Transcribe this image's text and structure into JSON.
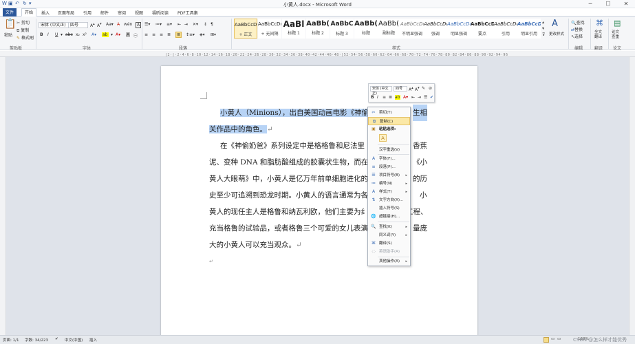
{
  "window": {
    "title": "小黄人.docx - Microsoft Word",
    "controls": [
      "─",
      "☐",
      "✕"
    ]
  },
  "tabs": [
    "文件",
    "开始",
    "插入",
    "页面布局",
    "引用",
    "邮件",
    "审阅",
    "视图",
    "福昕阅读",
    "PDF工具集"
  ],
  "ribbon": {
    "clipboard": {
      "paste": "粘贴",
      "cut": "剪切",
      "copy": "复制",
      "format_painter": "格式刷",
      "group": "剪贴板"
    },
    "font": {
      "name": "宋体 (中文正)",
      "size": "四号",
      "group": "字体"
    },
    "paragraph": {
      "group": "段落"
    },
    "styles": {
      "items": [
        {
          "preview": "AaBbCcDd",
          "name": "+ 正文"
        },
        {
          "preview": "AaBbCcDd",
          "name": "+ 无间隔"
        },
        {
          "preview": "AaBl",
          "name": "标题 1"
        },
        {
          "preview": "AaBb(",
          "name": "标题 2"
        },
        {
          "preview": "AaBbC",
          "name": "标题 3"
        },
        {
          "preview": "AaBb(",
          "name": "标题"
        },
        {
          "preview": "AaBb(",
          "name": "副标题"
        },
        {
          "preview": "AaBbCcDd",
          "name": "不明显强调"
        },
        {
          "preview": "AaBbCcDd",
          "name": "强调"
        },
        {
          "preview": "AaBbCcDd",
          "name": "明显强调"
        },
        {
          "preview": "AaBbCcDd",
          "name": "要点"
        },
        {
          "preview": "AaBbCcDd",
          "name": "引用"
        },
        {
          "preview": "AaBbCcDd",
          "name": "明显引用"
        }
      ],
      "change": "更改样式",
      "group": "样式"
    },
    "editing": {
      "find": "查找",
      "replace": "替换",
      "select": "选择",
      "group": "编辑"
    },
    "translate": {
      "full": "全文翻译",
      "group": "翻译"
    },
    "thesis": {
      "check": "论文查重",
      "group": "论文"
    }
  },
  "document": {
    "paragraphs": [
      [
        "小黄人（Minions），出自美国动画电影《神偷",
        "关作品中的角色。"
      ],
      [
        "在《神偷奶爸》系列设定中是格格鲁和尼法里",
        "泥、变种 DNA 和脂肪酸组成的胶囊状生物，而在小",
        "黄人大眼萌》中，小黄人是亿万年前单细胞进化的",
        "史至少可追溯到恐龙时期。小黄人的语言通常为各",
        "黄人的现任主人是格鲁和纳瓦利欧，他们主要为纟",
        "充当格鲁的试验品，或者格鲁三个可爱的女儿表演",
        "大的小黄人可以充当观众。"
      ]
    ],
    "tail_right": [
      "生相",
      "香蕉",
      "《小",
      "的历",
      "小",
      "工程、",
      "量庞"
    ]
  },
  "mini_toolbar": {
    "font": "宋体 (中文正)",
    "size": "四号"
  },
  "context_menu": {
    "items": [
      {
        "label": "剪切(T)",
        "icon": "cut-icon"
      },
      {
        "label": "复制(C)",
        "icon": "copy-icon",
        "hover": true
      },
      {
        "label": "粘贴选项:",
        "icon": "paste-icon"
      },
      {
        "label": "汉字重选(V)",
        "icon": ""
      },
      {
        "label": "字体(F)...",
        "icon": "font-icon"
      },
      {
        "label": "段落(P)...",
        "icon": "paragraph-icon"
      },
      {
        "label": "项目符号(B)",
        "icon": "bullets-icon",
        "sub": true
      },
      {
        "label": "编号(N)",
        "icon": "numbering-icon",
        "sub": true
      },
      {
        "label": "样式(T)",
        "icon": "styles-icon",
        "sub": true
      },
      {
        "label": "文字方向(X)...",
        "icon": "text-direction-icon"
      },
      {
        "label": "插入符号(S)",
        "icon": ""
      },
      {
        "label": "超链接(H)...",
        "icon": "hyperlink-icon"
      },
      {
        "label": "查找(K)",
        "icon": "find-icon",
        "sub": true
      },
      {
        "label": "同义词(Y)",
        "icon": "",
        "sub": true
      },
      {
        "label": "翻译(S)",
        "icon": "translate-icon"
      },
      {
        "label": "英语助手(A)",
        "icon": "",
        "disabled": true
      },
      {
        "label": "其他操作(A)",
        "icon": "",
        "sub": true
      }
    ]
  },
  "status": {
    "page": "页面: 1/1",
    "words": "字数: 34/223",
    "language": "中文(中国)",
    "mode": "插入",
    "zoom": "120%",
    "watermark": "CSDN @怎么样才能优秀"
  }
}
